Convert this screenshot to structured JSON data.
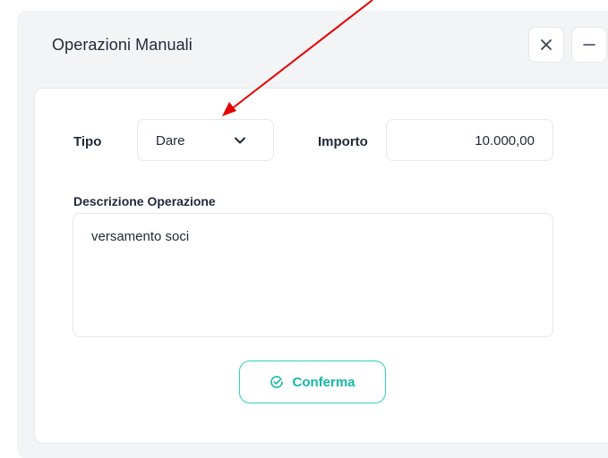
{
  "dialog": {
    "title": "Operazioni Manuali"
  },
  "form": {
    "tipo_label": "Tipo",
    "tipo_value": "Dare",
    "importo_label": "Importo",
    "importo_value": "10.000,00",
    "descrizione_label": "Descrizione Operazione",
    "descrizione_value": "versamento soci",
    "confirm_label": "Conferma"
  },
  "icons": {
    "close": "close-icon",
    "minimize": "minimize-icon",
    "chevron": "chevron-down-icon",
    "confirm": "check-circle-icon"
  },
  "colors": {
    "accent": "#14b8a6",
    "annotation_arrow": "#e60000"
  }
}
